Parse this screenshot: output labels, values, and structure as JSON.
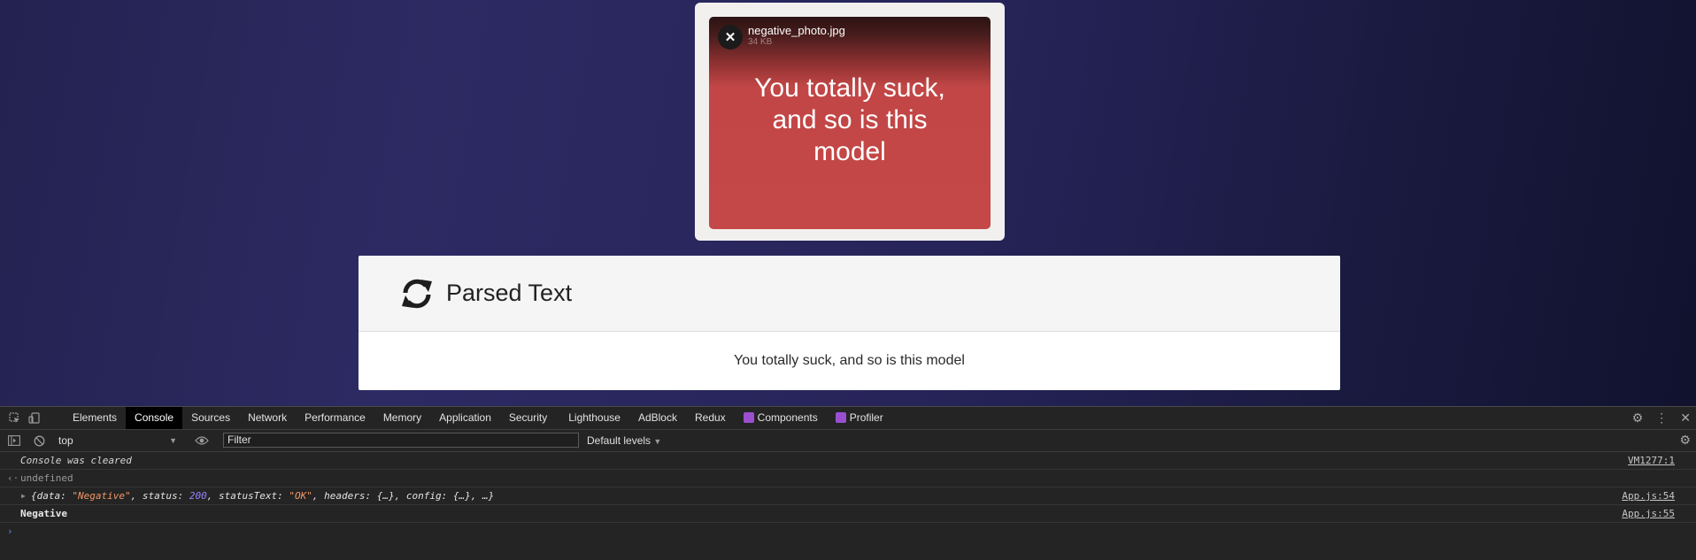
{
  "upload": {
    "file_name": "negative_photo.jpg",
    "file_size": "34 KB",
    "close_glyph": "✕",
    "image_text": "You  totally suck,\nand so is this\nmodel"
  },
  "parsed": {
    "title": "Parsed Text",
    "body": "You totally suck, and so is this model"
  },
  "devtools": {
    "tabs": [
      "Elements",
      "Console",
      "Sources",
      "Network",
      "Performance",
      "Memory",
      "Application",
      "Security",
      "Lighthouse",
      "AdBlock",
      "Redux",
      "Components",
      "Profiler"
    ],
    "active_tab": "Console",
    "context": "top",
    "filter_placeholder": "Filter",
    "levels": "Default levels",
    "console": {
      "cleared": "Console was cleared",
      "cleared_src": "VM1277:1",
      "result": "undefined",
      "obj_prefix": "{data: ",
      "obj_data": "\"Negative\"",
      "obj_status_key": ", status: ",
      "obj_status": "200",
      "obj_statustext_key": ", statusText: ",
      "obj_statustext": "\"OK\"",
      "obj_suffix": ", headers: {…}, config: {…}, …}",
      "obj_src": "App.js:54",
      "negative": "Negative",
      "negative_src": "App.js:55"
    }
  }
}
